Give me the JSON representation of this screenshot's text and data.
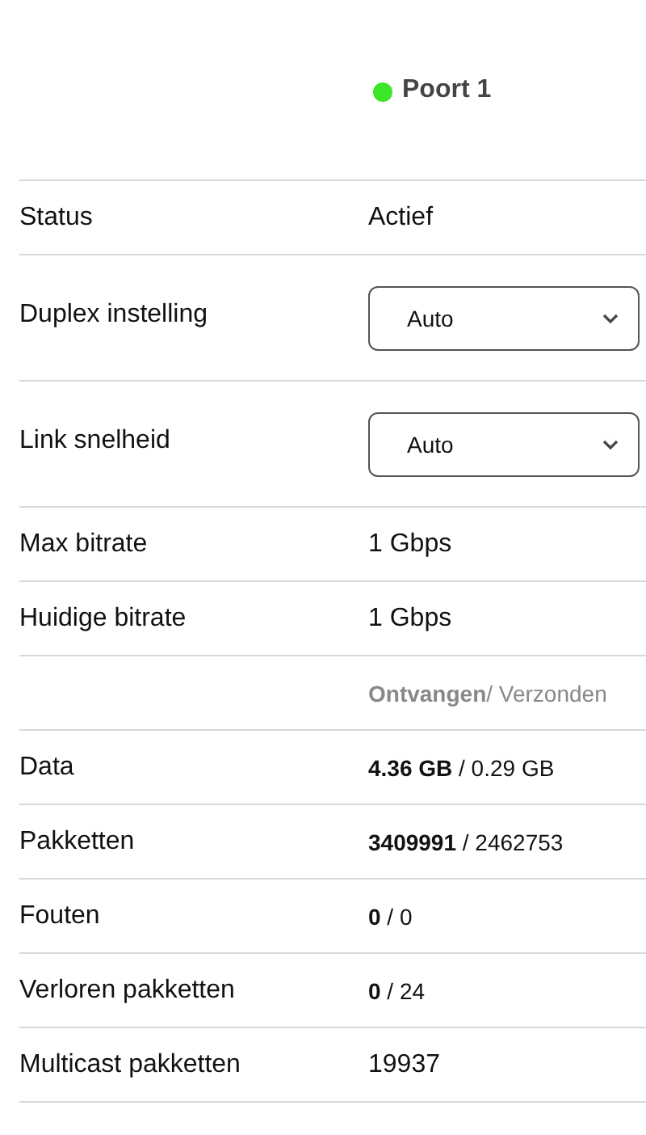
{
  "port": {
    "name": "Poort 1",
    "color": "#3ee62a"
  },
  "rows": [
    {
      "kind": "text",
      "label": "Status",
      "value": "Actief"
    },
    {
      "kind": "select",
      "label": "Duplex instelling",
      "value": "Auto"
    },
    {
      "kind": "select",
      "label": "Link snelheid",
      "value": "Auto"
    },
    {
      "kind": "text",
      "label": "Max bitrate",
      "value": "1 Gbps"
    },
    {
      "kind": "text",
      "label": "Huidige bitrate",
      "value": "1 Gbps"
    },
    {
      "kind": "header",
      "value": "**Ontvangen**/ Verzonden"
    },
    {
      "kind": "pair",
      "label": "Data",
      "value": "**4.36 GB** / 0.29 GB"
    },
    {
      "kind": "pair",
      "label": "Pakketten",
      "value": "**3409991** / 2462753"
    },
    {
      "kind": "pair",
      "label": "Fouten",
      "value": "**0** / 0"
    },
    {
      "kind": "pair",
      "label": "Verloren pakketten",
      "value": "**0** / 24"
    },
    {
      "kind": "text",
      "label": "Multicast pakketten",
      "value": "19937"
    }
  ]
}
